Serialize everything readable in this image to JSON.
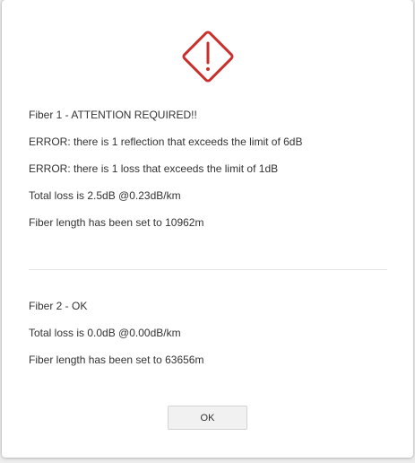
{
  "dialog": {
    "icon": "warning-diamond-icon",
    "accent_color": "#c9302c",
    "fiber1": {
      "lines": [
        "Fiber 1 - ATTENTION REQUIRED!!",
        "ERROR: there is 1 reflection that exceeds the limit of 6dB",
        "ERROR: there is 1 loss that exceeds the limit of 1dB",
        "Total loss is 2.5dB @0.23dB/km",
        "Fiber length has been set to 10962m"
      ]
    },
    "fiber2": {
      "lines": [
        "Fiber 2 - OK",
        "Total loss is 0.0dB @0.00dB/km",
        "Fiber length has been set to 63656m"
      ]
    },
    "ok_label": "OK"
  }
}
